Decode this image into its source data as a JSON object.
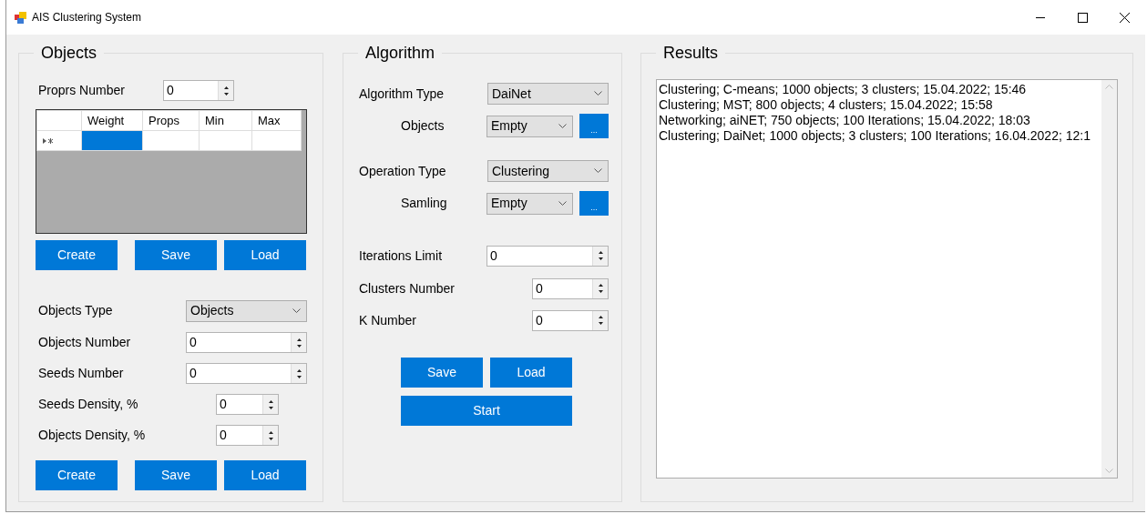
{
  "window": {
    "title": "AIS Clustering System"
  },
  "objects_group": {
    "title": "Objects",
    "props_number": {
      "label": "Proprs Number",
      "value": "0"
    },
    "grid": {
      "columns": [
        "Weight",
        "Props",
        "Min",
        "Max"
      ],
      "new_row_cells": [
        {
          "selected": true
        },
        {
          "selected": false
        },
        {
          "selected": false
        },
        {
          "selected": false
        }
      ]
    },
    "grid_buttons": [
      "Create",
      "Save",
      "Load"
    ],
    "fields": [
      {
        "kind": "combo",
        "label": "Objects Type",
        "value": "Objects"
      },
      {
        "kind": "spin",
        "label": "Objects Number",
        "value": "0"
      },
      {
        "kind": "spin",
        "label": "Seeds Number",
        "value": "0"
      },
      {
        "kind": "spin",
        "label": "Seeds Density, %",
        "value": "0"
      },
      {
        "kind": "spin",
        "label": "Objects Density, %",
        "value": "0"
      }
    ],
    "buttons": [
      "Create",
      "Save",
      "Load"
    ]
  },
  "algorithm_group": {
    "title": "Algorithm",
    "fields": [
      {
        "kind": "combo",
        "label": "Algorithm Type",
        "value": "DaiNet"
      },
      {
        "kind": "combo_browse",
        "label": "Objects",
        "value": "Empty",
        "browse": "..."
      },
      {
        "kind": "combo",
        "label": "Operation Type",
        "value": "Clustering"
      },
      {
        "kind": "combo_browse",
        "label": "Samling",
        "value": "Empty",
        "browse": "..."
      },
      {
        "kind": "spin",
        "label": "Iterations Limit",
        "value": "0"
      },
      {
        "kind": "spin",
        "label": "Clusters Number",
        "value": "0"
      },
      {
        "kind": "spin",
        "label": "K Number",
        "value": "0"
      }
    ],
    "buttons": [
      "Save",
      "Load"
    ],
    "start_button": "Start"
  },
  "results_group": {
    "title": "Results",
    "lines": [
      "Clustering; C-means; 1000 objects; 3 clusters; 15.04.2022; 15:46",
      "Clustering; MST; 800 objects; 4 clusters; 15.04.2022; 15:58",
      "Networking; aiNET; 750 objects; 100 Iterations; 15.04.2022; 18:03",
      "Clustering; DaiNet; 1000 objects; 3 clusters; 100 Iterations; 16.04.2022; 12:1"
    ]
  }
}
